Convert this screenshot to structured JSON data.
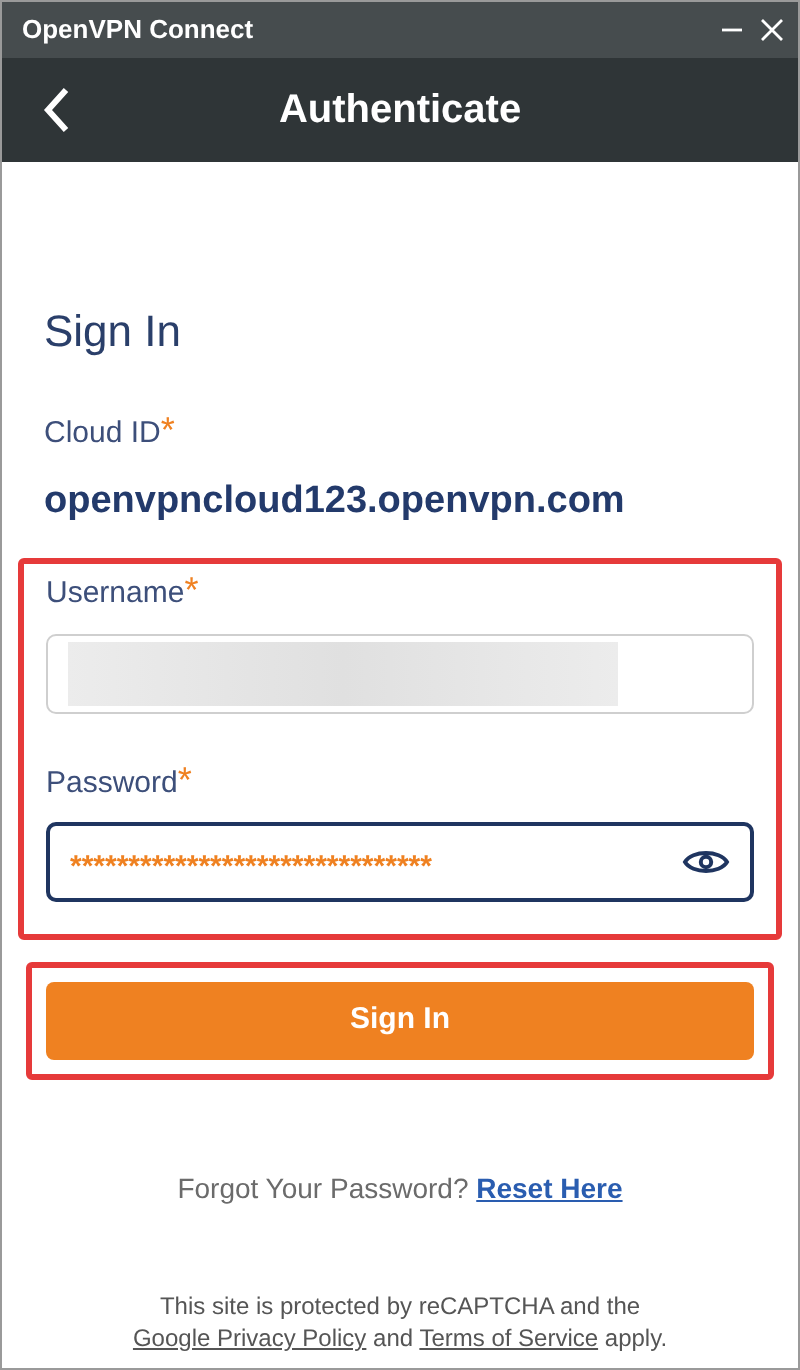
{
  "window": {
    "title": "OpenVPN Connect"
  },
  "header": {
    "title": "Authenticate"
  },
  "form": {
    "heading": "Sign In",
    "cloud_id": {
      "label": "Cloud ID",
      "required": true,
      "required_mark": "*",
      "value": "openvpncloud123.openvpn.com"
    },
    "username": {
      "label": "Username",
      "required": true,
      "required_mark": "*",
      "redacted": true
    },
    "password": {
      "label": "Password",
      "required": true,
      "required_mark": "*",
      "value": "*******************************",
      "focused": true
    },
    "submit": "Sign In"
  },
  "highlights": {
    "credentials": true,
    "submit": true
  },
  "forgot": {
    "text": "Forgot Your Password?",
    "link": "Reset Here"
  },
  "notice": {
    "before": "This site is protected by reCAPTCHA and the",
    "link1": "Google Privacy Policy",
    "middle": "and",
    "link2": "Terms of Service",
    "after": "apply."
  }
}
